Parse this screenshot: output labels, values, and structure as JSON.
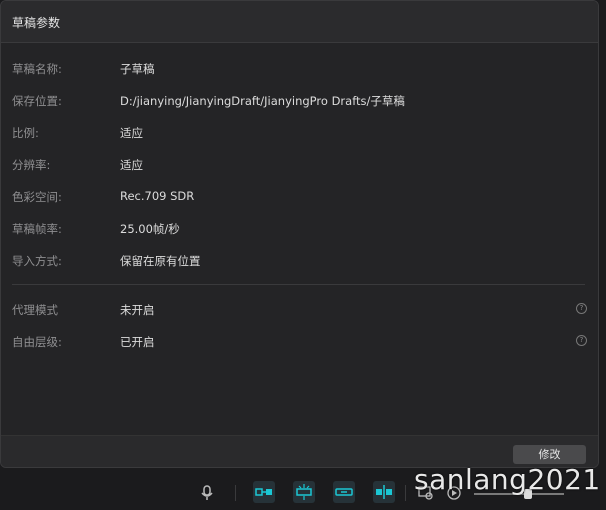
{
  "dialog": {
    "title": "草稿参数",
    "rows": [
      {
        "label": "草稿名称:",
        "value": "子草稿"
      },
      {
        "label": "保存位置:",
        "value": "D:/jianying/JianyingDraft/JianyingPro Drafts/子草稿"
      },
      {
        "label": "比例:",
        "value": "适应"
      },
      {
        "label": "分辨率:",
        "value": "适应"
      },
      {
        "label": "色彩空间:",
        "value": "Rec.709 SDR"
      },
      {
        "label": "草稿帧率:",
        "value": "25.00帧/秒"
      },
      {
        "label": "导入方式:",
        "value": "保留在原有位置"
      }
    ],
    "options": [
      {
        "label": "代理模式",
        "value": "未开启"
      },
      {
        "label": "自由层级:",
        "value": "已开启"
      }
    ],
    "help_glyph": "?",
    "edit_button": "修改"
  },
  "toolbar": {
    "icons": [
      "microphone-icon",
      "link-clip-icon",
      "auto-snap-icon",
      "link-track-icon",
      "split-preview-icon",
      "zoom-fit-icon",
      "play-icon",
      "zoom-slider-icon"
    ]
  },
  "watermark": "sanlang2021",
  "colors": {
    "accent": "#1bc7d4",
    "background": "#242426",
    "button": "#4a4a4c"
  }
}
